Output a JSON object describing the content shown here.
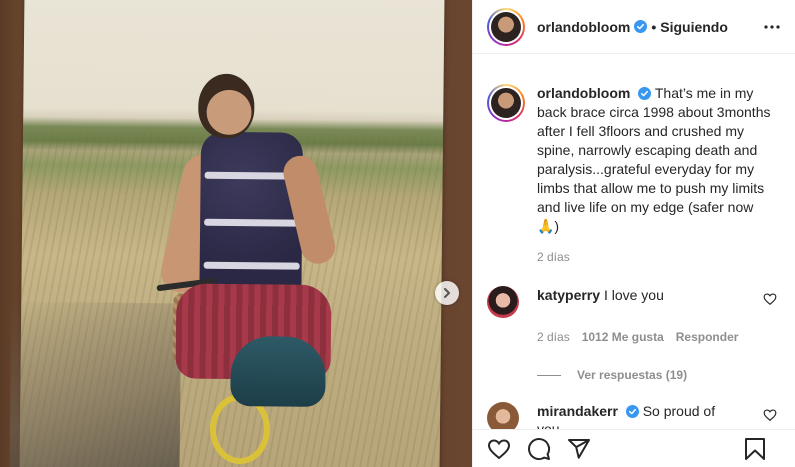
{
  "post": {
    "username": "orlandobloom",
    "dot": "•",
    "follow_status": "Siguiendo",
    "caption": "That’s me in my back brace circa 1998 about 3months after I fell 3floors and crushed my spine, narrowly escaping death and paralysis...grateful everyday for my limbs that allow me to push my limits and live life on my edge (safer now 🙏)",
    "caption_time": "2 días",
    "icons": {
      "verified": "verified-badge-icon",
      "more": "more-options-icon",
      "next": "chevron-right-icon",
      "like": "heart-outline-icon",
      "comment": "comment-bubble-icon",
      "share": "paper-plane-icon",
      "save": "bookmark-icon"
    }
  },
  "comments": [
    {
      "username": "katyperry",
      "verified": false,
      "text": "I love you",
      "time": "2 días",
      "likes": "1012 Me gusta",
      "reply": "Responder",
      "view_replies": "Ver respuestas (19)"
    },
    {
      "username": "mirandakerr",
      "verified": true,
      "text": "So proud of you",
      "emoji": "❤"
    }
  ],
  "colors": {
    "verified_blue": "#3897f0",
    "text": "#262626",
    "muted": "#8e8e8e",
    "heart_red": "#ed4956"
  }
}
